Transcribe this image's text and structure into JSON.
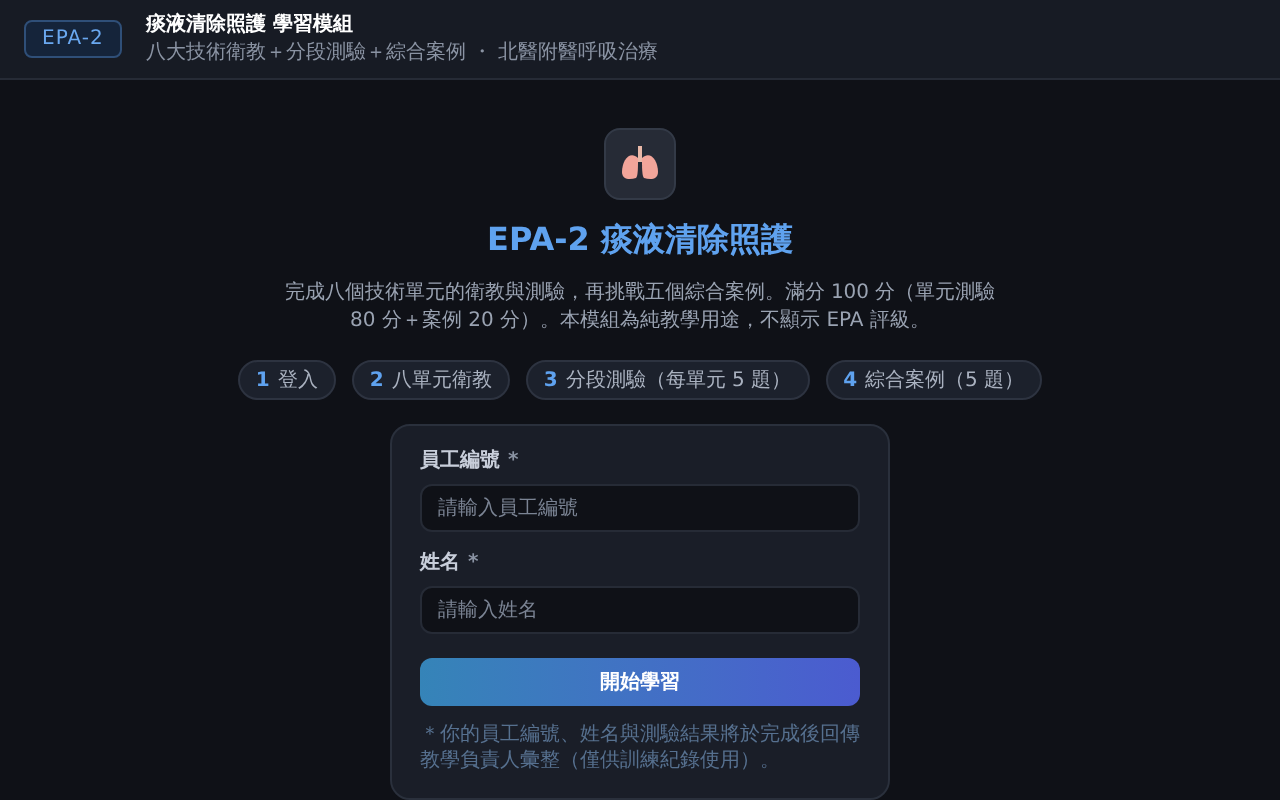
{
  "header": {
    "badge": "EPA-2",
    "title": "痰液清除照護 學習模組",
    "subtitle": "八大技術衛教＋分段測驗＋綜合案例 ・ 北醫附醫呼吸治療"
  },
  "hero": {
    "title": "EPA-2 痰液清除照護",
    "description": "完成八個技術單元的衛教與測驗，再挑戰五個綜合案例。滿分 100 分（單元測驗 80 分＋案例 20 分）。本模組為純教學用途，不顯示 EPA 評級。"
  },
  "steps": [
    {
      "number": "1",
      "label": "登入"
    },
    {
      "number": "2",
      "label": "八單元衛教"
    },
    {
      "number": "3",
      "label": "分段測驗（每單元 5 題）"
    },
    {
      "number": "4",
      "label": "綜合案例（5 題）"
    }
  ],
  "form": {
    "fields": [
      {
        "label": "員工編號",
        "required_mark": "*",
        "placeholder": "請輸入員工編號"
      },
      {
        "label": "姓名",
        "required_mark": "*",
        "placeholder": "請輸入姓名"
      }
    ],
    "submit": "開始學習",
    "note": "＊你的員工編號、姓名與測驗結果將於完成後回傳教學負責人彙整（僅供訓練紀錄使用）。"
  }
}
